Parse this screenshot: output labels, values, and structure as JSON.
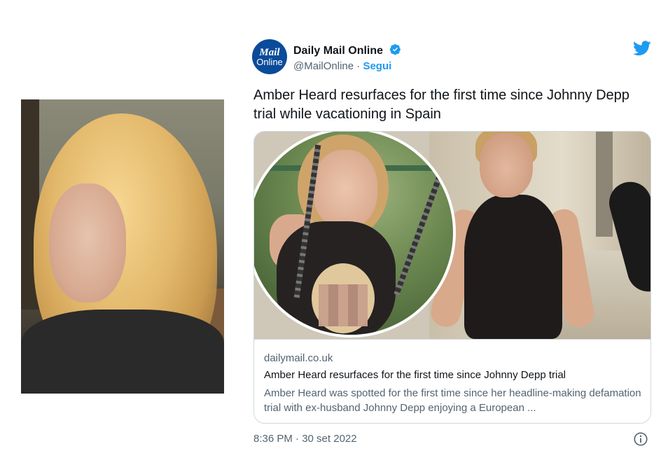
{
  "left_photo": {
    "alt": "Amber Heard in court"
  },
  "tweet": {
    "avatar": {
      "line1": "Mail",
      "line2": "Online"
    },
    "author_name": "Daily Mail Online",
    "handle": "@MailOnline",
    "separator": " · ",
    "follow_label": "Segui",
    "text": "Amber Heard resurfaces for the first time since Johnny Depp trial while vacationing in Spain",
    "card": {
      "domain": "dailymail.co.uk",
      "title": "Amber Heard resurfaces for the first time since Johnny Depp trial",
      "description": "Amber Heard was spotted for the first time since her headline-making defamation trial with ex-husband Johnny Depp enjoying a European ..."
    },
    "timestamp": "8:36 PM · 30 set 2022"
  },
  "colors": {
    "twitter_blue": "#1d9bf0",
    "verified": "#1d9bf0",
    "mail_blue": "#0a4b9a",
    "secondary_text": "#536471"
  },
  "icons": {
    "verified": "verified-badge-icon",
    "twitter": "twitter-bird-icon",
    "info": "info-icon"
  }
}
